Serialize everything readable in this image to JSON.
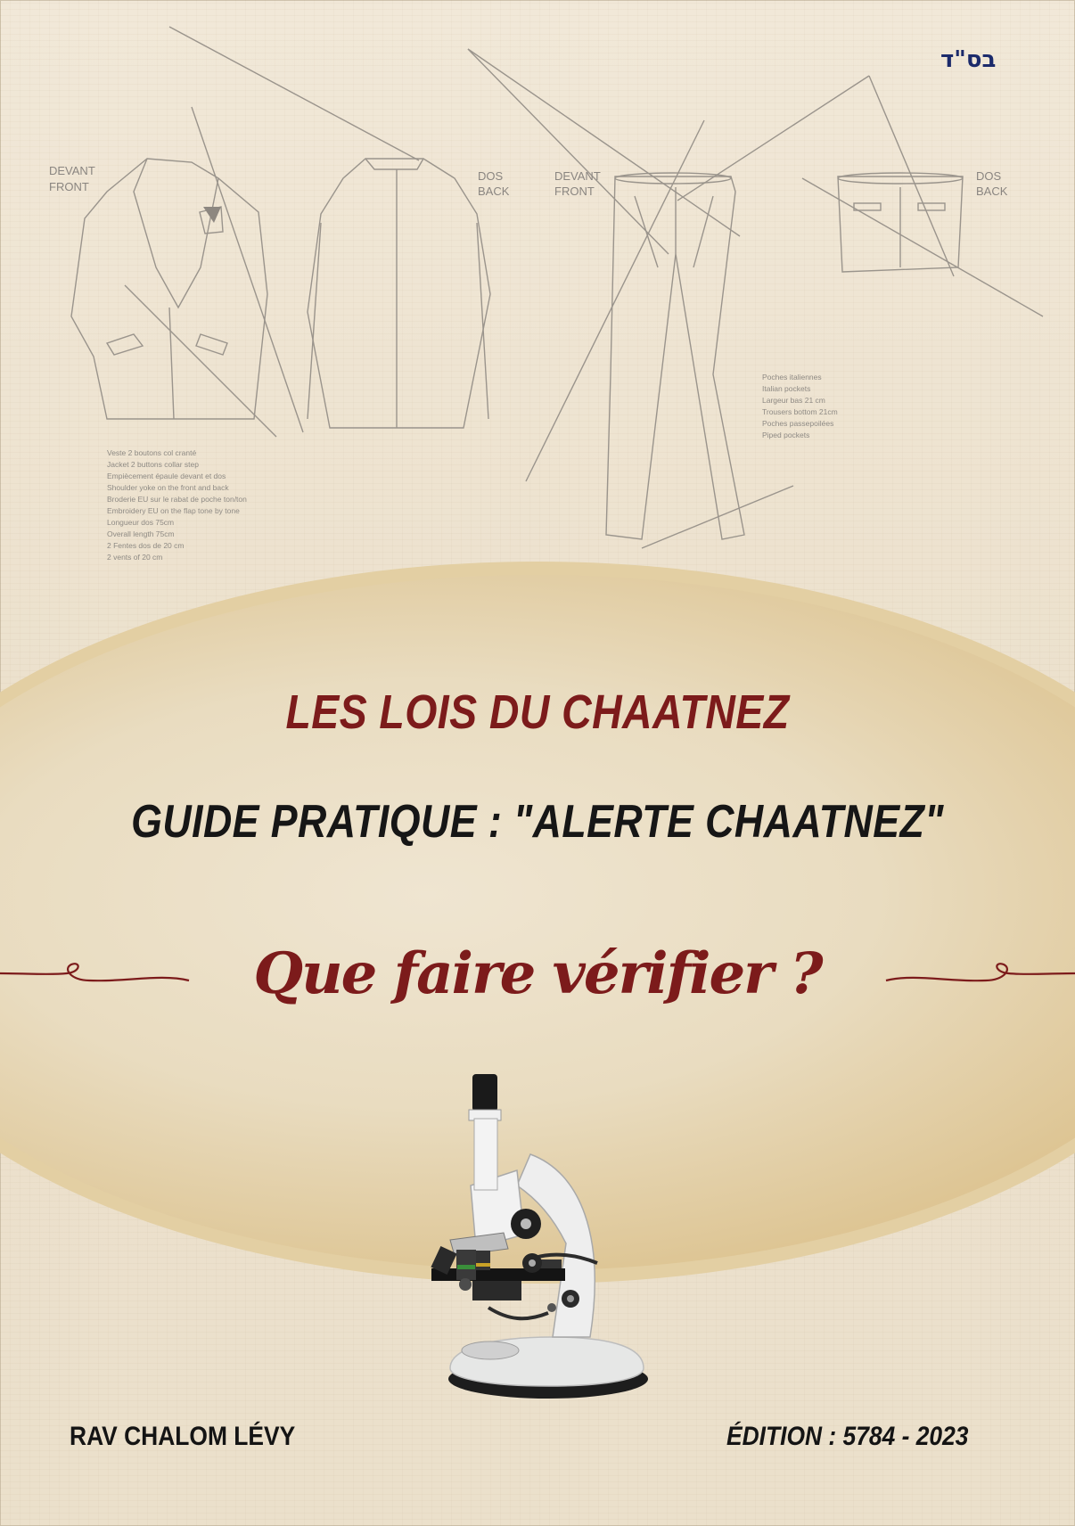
{
  "header": {
    "hebrew_mark": "בס\"ד"
  },
  "sketch": {
    "jacket_front_label_fr": "DEVANT",
    "jacket_front_label_en": "FRONT",
    "jacket_back_label_fr": "DOS",
    "jacket_back_label_en": "BACK",
    "pants_front_label_fr": "DEVANT",
    "pants_front_label_en": "FRONT",
    "pants_back_label_fr": "DOS",
    "pants_back_label_en": "BACK",
    "jacket_notes": [
      "Veste 2 boutons col cranté",
      "Jacket 2 buttons collar step",
      "Empiècement épaule devant et dos",
      "Shoulder yoke on the front and back",
      "Broderie EU sur le rabat de poche ton/ton",
      "Embroidery EU on the flap tone by tone",
      "Longueur dos 75cm",
      "Overall length 75cm",
      "2 Fentes dos de 20 cm",
      "2 vents of 20 cm"
    ],
    "pants_notes": [
      "Poches italiennes",
      "Italian pockets",
      "Largeur bas 21 cm",
      "Trousers bottom 21cm",
      "Poches passepoilées",
      "Piped pockets"
    ]
  },
  "cover": {
    "title": "LES LOIS DU CHAATNEZ",
    "subtitle": "GUIDE PRATIQUE : \"ALERTE CHAATNEZ\"",
    "question": "Que faire vérifier ?",
    "author": "RAV CHALOM LÉVY",
    "edition": "ÉDITION : 5784 - 2023"
  },
  "colors": {
    "title_red": "#7c1b1b",
    "subtitle_black": "#161616",
    "hebrew_blue": "#1b2a6b",
    "ellipse_gold": "#d6b778",
    "parchment": "#ece1cd"
  }
}
